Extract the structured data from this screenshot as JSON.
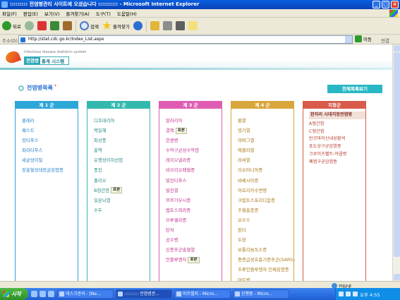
{
  "window": {
    "title": "::::::::: 전염병관리 사이트에 오셨습니다 :::::::::: - Microsoft Internet Explorer"
  },
  "menu": [
    "파일(F)",
    "편집(E)",
    "보기(V)",
    "즐겨찾기(A)",
    "도구(T)",
    "도움말(H)"
  ],
  "toolbar": {
    "back_label": "뒤로",
    "search_label": "검색",
    "favorites_label": "즐겨찾기"
  },
  "address": {
    "label": "주소(D)",
    "url": "http://stat.cdc.go.kr/Index_List.aspx",
    "go_label": "이동",
    "links_label": "연결"
  },
  "site": {
    "logo_small": "Infectious disease statistics system",
    "logo_highlight": "전염병",
    "logo_rest": "통계 시스템",
    "section_title": "전염병목록",
    "view_all_button": "전체목록보기"
  },
  "columns": [
    {
      "header": "제 1 군",
      "items": [
        {
          "label": "콜레라"
        },
        {
          "label": "페스트"
        },
        {
          "label": "장티푸스"
        },
        {
          "label": "파라티푸스"
        },
        {
          "label": "세균성이질"
        },
        {
          "label": "장출혈성대장균감염증"
        }
      ]
    },
    {
      "header": "제 2 군",
      "items": [
        {
          "label": "디프테리아"
        },
        {
          "label": "백일해"
        },
        {
          "label": "파상풍"
        },
        {
          "label": "홍역"
        },
        {
          "label": "유행성이하선염"
        },
        {
          "label": "풍진"
        },
        {
          "label": "폴리오"
        },
        {
          "label": "B형간염",
          "badge": "표본"
        },
        {
          "label": "일본뇌염"
        },
        {
          "label": "수두"
        }
      ]
    },
    {
      "header": "제 3 군",
      "items": [
        {
          "label": "말라리아"
        },
        {
          "label": "결핵",
          "badge": "표본"
        },
        {
          "label": "한센병"
        },
        {
          "label": "수막구균성수막염"
        },
        {
          "label": "레지오넬라증"
        },
        {
          "label": "비브리오패혈증"
        },
        {
          "label": "발진티푸스"
        },
        {
          "label": "발진열"
        },
        {
          "label": "쯔쯔가무시증"
        },
        {
          "label": "렙토스피라증"
        },
        {
          "label": "브루셀라증"
        },
        {
          "label": "탄저"
        },
        {
          "label": "공수병"
        },
        {
          "label": "신증후군출혈열"
        },
        {
          "label": "인플루엔자",
          "badge": "표본"
        }
      ]
    },
    {
      "header": "제 4 군",
      "items": [
        {
          "label": "황열"
        },
        {
          "label": "뎅기열"
        },
        {
          "label": "마버그열"
        },
        {
          "label": "에볼라열"
        },
        {
          "label": "라싸열"
        },
        {
          "label": "리슈마니아증"
        },
        {
          "label": "바베시아증"
        },
        {
          "label": "아프리카수면병"
        },
        {
          "label": "크립토스포리디움증"
        },
        {
          "label": "주혈흡충증"
        },
        {
          "label": "요우스"
        },
        {
          "label": "핀타"
        },
        {
          "label": "두창"
        },
        {
          "label": "보튤리눔독소증"
        },
        {
          "label": "중증급성호흡기증후군(SARS)"
        },
        {
          "label": "조류인플루엔자 인체감염증"
        },
        {
          "label": "야토병"
        }
      ]
    },
    {
      "header": "지정군",
      "headline": "한자리 시대지정전염병",
      "items": [
        {
          "label": "A형간염"
        },
        {
          "label": "C형간염"
        },
        {
          "label": "반코마이신내성황색"
        },
        {
          "label": "포도상구균감염증"
        },
        {
          "label": "크로이츠펠트-야콥병"
        },
        {
          "label": "폐렴구균감염증"
        }
      ]
    }
  ],
  "statusbar": {
    "zone_label": "인터넷"
  },
  "taskbar": {
    "start_label": "시작",
    "tasks": [
      "데스크관리 - [Ne...",
      ":::::::::: 전염병관...",
      "마르셀지 - Micro...",
      "진행중 - Micro..."
    ],
    "clock": "오후 4:55"
  }
}
